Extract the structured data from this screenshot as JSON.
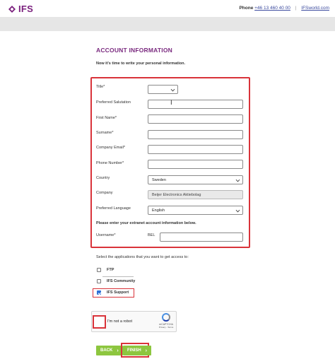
{
  "header": {
    "logo_text": "IFS",
    "phone_label": "Phone",
    "phone_number": "+46 13 460 40 00",
    "separator": "|",
    "website": "IFSworld.com",
    "brand_color": "#7a1f7d"
  },
  "page": {
    "title": "ACCOUNT INFORMATION",
    "subtitle": "Now it's time to write your personal information."
  },
  "form": {
    "title_label": "Title*",
    "title_value": "",
    "salutation_label": "Preferred Salutation",
    "salutation_value": "",
    "first_name_label": "First Name*",
    "first_name_value": "",
    "surname_label": "Surname*",
    "surname_value": "",
    "email_label": "Company Email*",
    "email_value": "",
    "phone_label": "Phone Number*",
    "phone_value": "",
    "country_label": "Country",
    "country_value": "Sweden",
    "company_label": "Company",
    "company_value": "Beijer Electronics Aktiebolag",
    "language_label": "Preferred Language",
    "language_value": "English",
    "extranet_note": "Please enter your extranet account information below.",
    "username_label": "Username*",
    "username_prefix": "BEL",
    "username_value": ""
  },
  "applications": {
    "prompt": "Select the applications that you want to get access to:",
    "items": [
      {
        "label": "FTP",
        "checked": false
      },
      {
        "label": "IFS Community",
        "checked": false
      },
      {
        "label": "IFS Support",
        "checked": true
      }
    ]
  },
  "captcha": {
    "label": "I'm not a robot",
    "brand": "reCAPTCHA",
    "terms": "Privacy - Terms"
  },
  "buttons": {
    "back": "BACK",
    "finish": "FINISH",
    "arrow": "›",
    "color": "#8dc63f"
  },
  "highlight_color": "#d9333a"
}
